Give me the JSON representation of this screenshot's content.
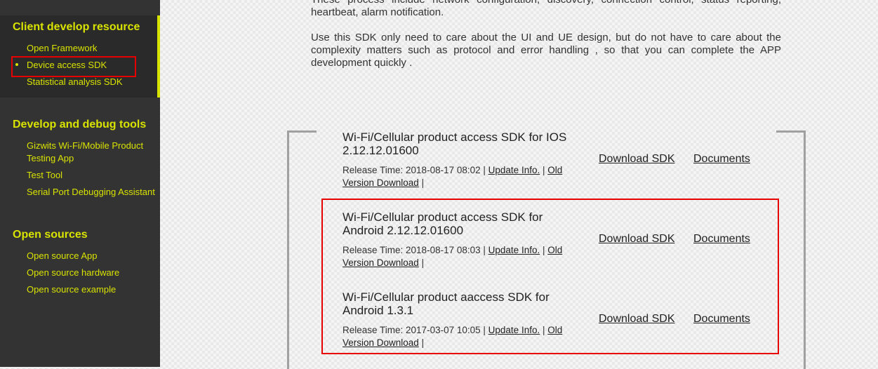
{
  "sidebar": {
    "sections": [
      {
        "title": "Client develop resource",
        "items": [
          {
            "label": "Open Framework"
          },
          {
            "label": "Device access SDK",
            "active": true
          },
          {
            "label": "Statistical analysis SDK"
          }
        ]
      },
      {
        "title": "Develop and debug tools",
        "items": [
          {
            "label": "Gizwits Wi-Fi/Mobile Product Testing App"
          },
          {
            "label": "Test Tool"
          },
          {
            "label": "Serial Port Debugging Assistant"
          }
        ]
      },
      {
        "title": "Open sources",
        "items": [
          {
            "label": "Open source App"
          },
          {
            "label": "Open source hardware"
          },
          {
            "label": "Open source example"
          }
        ]
      }
    ]
  },
  "intro": {
    "para1": "These process include network configuration, discovery, connection control, status reporting, heartbeat, alarm notification.",
    "para2": "Use this SDK only need to care about the UI and UE design, but do not have to care about the complexity matters such as protocol and error handling , so that you can complete the APP development quickly ."
  },
  "sdks": [
    {
      "title": "Wi-Fi/Cellular product access SDK for IOS 2.12.12.01600",
      "release_label": "Release Time: 2018-08-17 08:02 |",
      "update_info": "Update Info.",
      "old_version": "Old Version Download",
      "sep": "|",
      "download": "Download SDK",
      "documents": "Documents"
    },
    {
      "title": "Wi-Fi/Cellular product access SDK for Android 2.12.12.01600",
      "release_label": "Release Time: 2018-08-17 08:03 |",
      "update_info": "Update Info.",
      "old_version": "Old Version Download",
      "sep": "|",
      "download": "Download SDK",
      "documents": "Documents"
    },
    {
      "title": "Wi-Fi/Cellular product aaccess SDK for Android 1.3.1",
      "release_label": "Release Time: 2017-03-07 10:05 |",
      "update_info": "Update Info.",
      "old_version": "Old Version Download",
      "sep": "|",
      "download": "Download SDK",
      "documents": "Documents"
    }
  ],
  "colors": {
    "accent": "#d9e300",
    "highlight_box": "#e60000",
    "sidebar_bg": "#333333"
  }
}
